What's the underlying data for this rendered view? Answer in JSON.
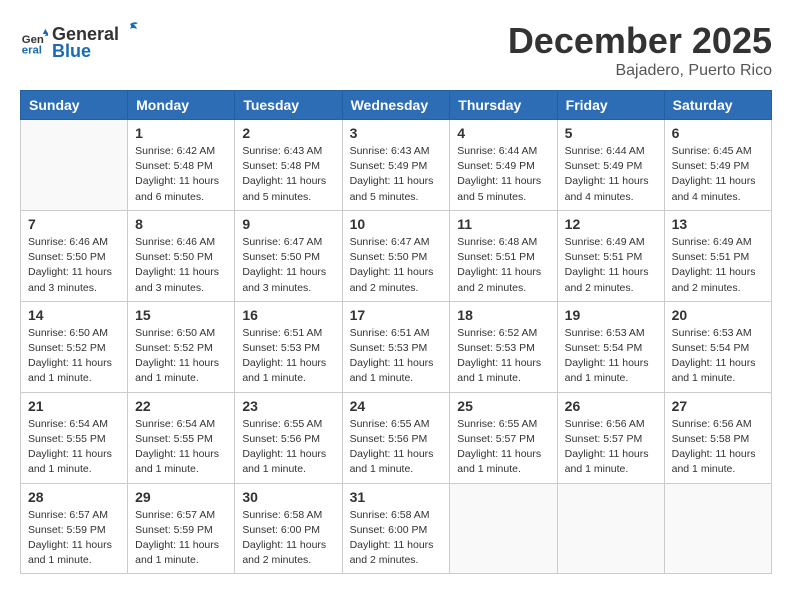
{
  "header": {
    "logo_general": "General",
    "logo_blue": "Blue",
    "month_title": "December 2025",
    "location": "Bajadero, Puerto Rico"
  },
  "days_of_week": [
    "Sunday",
    "Monday",
    "Tuesday",
    "Wednesday",
    "Thursday",
    "Friday",
    "Saturday"
  ],
  "weeks": [
    [
      {
        "day": "",
        "info": ""
      },
      {
        "day": "1",
        "info": "Sunrise: 6:42 AM\nSunset: 5:48 PM\nDaylight: 11 hours\nand 6 minutes."
      },
      {
        "day": "2",
        "info": "Sunrise: 6:43 AM\nSunset: 5:48 PM\nDaylight: 11 hours\nand 5 minutes."
      },
      {
        "day": "3",
        "info": "Sunrise: 6:43 AM\nSunset: 5:49 PM\nDaylight: 11 hours\nand 5 minutes."
      },
      {
        "day": "4",
        "info": "Sunrise: 6:44 AM\nSunset: 5:49 PM\nDaylight: 11 hours\nand 5 minutes."
      },
      {
        "day": "5",
        "info": "Sunrise: 6:44 AM\nSunset: 5:49 PM\nDaylight: 11 hours\nand 4 minutes."
      },
      {
        "day": "6",
        "info": "Sunrise: 6:45 AM\nSunset: 5:49 PM\nDaylight: 11 hours\nand 4 minutes."
      }
    ],
    [
      {
        "day": "7",
        "info": "Sunrise: 6:46 AM\nSunset: 5:50 PM\nDaylight: 11 hours\nand 3 minutes."
      },
      {
        "day": "8",
        "info": "Sunrise: 6:46 AM\nSunset: 5:50 PM\nDaylight: 11 hours\nand 3 minutes."
      },
      {
        "day": "9",
        "info": "Sunrise: 6:47 AM\nSunset: 5:50 PM\nDaylight: 11 hours\nand 3 minutes."
      },
      {
        "day": "10",
        "info": "Sunrise: 6:47 AM\nSunset: 5:50 PM\nDaylight: 11 hours\nand 2 minutes."
      },
      {
        "day": "11",
        "info": "Sunrise: 6:48 AM\nSunset: 5:51 PM\nDaylight: 11 hours\nand 2 minutes."
      },
      {
        "day": "12",
        "info": "Sunrise: 6:49 AM\nSunset: 5:51 PM\nDaylight: 11 hours\nand 2 minutes."
      },
      {
        "day": "13",
        "info": "Sunrise: 6:49 AM\nSunset: 5:51 PM\nDaylight: 11 hours\nand 2 minutes."
      }
    ],
    [
      {
        "day": "14",
        "info": "Sunrise: 6:50 AM\nSunset: 5:52 PM\nDaylight: 11 hours\nand 1 minute."
      },
      {
        "day": "15",
        "info": "Sunrise: 6:50 AM\nSunset: 5:52 PM\nDaylight: 11 hours\nand 1 minute."
      },
      {
        "day": "16",
        "info": "Sunrise: 6:51 AM\nSunset: 5:53 PM\nDaylight: 11 hours\nand 1 minute."
      },
      {
        "day": "17",
        "info": "Sunrise: 6:51 AM\nSunset: 5:53 PM\nDaylight: 11 hours\nand 1 minute."
      },
      {
        "day": "18",
        "info": "Sunrise: 6:52 AM\nSunset: 5:53 PM\nDaylight: 11 hours\nand 1 minute."
      },
      {
        "day": "19",
        "info": "Sunrise: 6:53 AM\nSunset: 5:54 PM\nDaylight: 11 hours\nand 1 minute."
      },
      {
        "day": "20",
        "info": "Sunrise: 6:53 AM\nSunset: 5:54 PM\nDaylight: 11 hours\nand 1 minute."
      }
    ],
    [
      {
        "day": "21",
        "info": "Sunrise: 6:54 AM\nSunset: 5:55 PM\nDaylight: 11 hours\nand 1 minute."
      },
      {
        "day": "22",
        "info": "Sunrise: 6:54 AM\nSunset: 5:55 PM\nDaylight: 11 hours\nand 1 minute."
      },
      {
        "day": "23",
        "info": "Sunrise: 6:55 AM\nSunset: 5:56 PM\nDaylight: 11 hours\nand 1 minute."
      },
      {
        "day": "24",
        "info": "Sunrise: 6:55 AM\nSunset: 5:56 PM\nDaylight: 11 hours\nand 1 minute."
      },
      {
        "day": "25",
        "info": "Sunrise: 6:55 AM\nSunset: 5:57 PM\nDaylight: 11 hours\nand 1 minute."
      },
      {
        "day": "26",
        "info": "Sunrise: 6:56 AM\nSunset: 5:57 PM\nDaylight: 11 hours\nand 1 minute."
      },
      {
        "day": "27",
        "info": "Sunrise: 6:56 AM\nSunset: 5:58 PM\nDaylight: 11 hours\nand 1 minute."
      }
    ],
    [
      {
        "day": "28",
        "info": "Sunrise: 6:57 AM\nSunset: 5:59 PM\nDaylight: 11 hours\nand 1 minute."
      },
      {
        "day": "29",
        "info": "Sunrise: 6:57 AM\nSunset: 5:59 PM\nDaylight: 11 hours\nand 1 minute."
      },
      {
        "day": "30",
        "info": "Sunrise: 6:58 AM\nSunset: 6:00 PM\nDaylight: 11 hours\nand 2 minutes."
      },
      {
        "day": "31",
        "info": "Sunrise: 6:58 AM\nSunset: 6:00 PM\nDaylight: 11 hours\nand 2 minutes."
      },
      {
        "day": "",
        "info": ""
      },
      {
        "day": "",
        "info": ""
      },
      {
        "day": "",
        "info": ""
      }
    ]
  ]
}
